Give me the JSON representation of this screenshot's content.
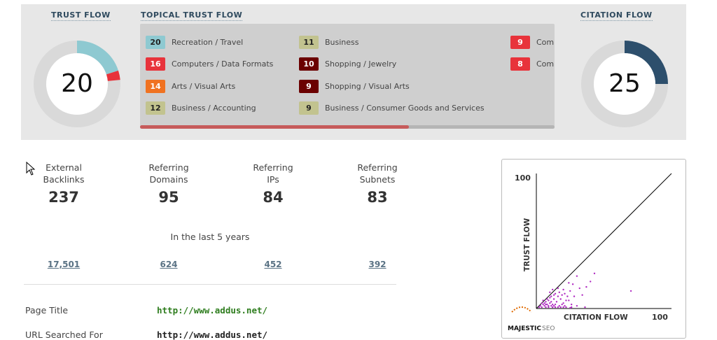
{
  "trust_flow": {
    "title": "TRUST FLOW",
    "value": "20",
    "level": 20,
    "colors": [
      "#8ec9d1",
      "#e8333b"
    ]
  },
  "citation_flow": {
    "title": "CITATION FLOW",
    "value": "25",
    "level": 25,
    "color": "#2d4f6c"
  },
  "topical": {
    "title": "TOPICAL TRUST FLOW",
    "items": [
      {
        "score": "20",
        "label": "Recreation / Travel",
        "color": "#8ec9d1"
      },
      {
        "score": "16",
        "label": "Computers / Data Formats",
        "color": "#e8333b"
      },
      {
        "score": "14",
        "label": "Arts / Visual Arts",
        "color": "#f07221"
      },
      {
        "score": "12",
        "label": "Business / Accounting",
        "color": "#c2c38f"
      },
      {
        "score": "11",
        "label": "Business",
        "color": "#c2c38f"
      },
      {
        "score": "10",
        "label": "Shopping / Jewelry",
        "color": "#6b0000"
      },
      {
        "score": "9",
        "label": "Shopping / Visual Arts",
        "color": "#6b0000"
      },
      {
        "score": "9",
        "label": "Business / Consumer Goods and Services",
        "color": "#c2c38f"
      },
      {
        "score": "9",
        "label": "Com",
        "color": "#e8333b"
      },
      {
        "score": "8",
        "label": "Com",
        "color": "#e8333b"
      }
    ]
  },
  "stats": [
    {
      "label_line1": "External",
      "label_line2": "Backlinks",
      "value": "237",
      "history": "17,501"
    },
    {
      "label_line1": "Referring",
      "label_line2": "Domains",
      "value": "95",
      "history": "624"
    },
    {
      "label_line1": "Referring",
      "label_line2": "IPs",
      "value": "84",
      "history": "452"
    },
    {
      "label_line1": "Referring",
      "label_line2": "Subnets",
      "value": "83",
      "history": "392"
    }
  ],
  "period_label": "In the last 5 years",
  "info": {
    "page_title_label": "Page Title",
    "page_title_value": "http://www.addus.net/",
    "url_label": "URL Searched For",
    "url_value": "http://www.addus.net/"
  },
  "chart_data": {
    "type": "scatter",
    "xlabel": "CITATION FLOW",
    "ylabel": "TRUST FLOW",
    "x_max_label": "100",
    "y_max_label": "100",
    "xlim": [
      0,
      100
    ],
    "ylim": [
      0,
      100
    ],
    "diagonal": true,
    "point_color": "#b02cc2",
    "points": [
      [
        2,
        1
      ],
      [
        3,
        2
      ],
      [
        4,
        1
      ],
      [
        5,
        3
      ],
      [
        5,
        6
      ],
      [
        6,
        2
      ],
      [
        6,
        4
      ],
      [
        7,
        5
      ],
      [
        7,
        1
      ],
      [
        8,
        3
      ],
      [
        8,
        7
      ],
      [
        9,
        6
      ],
      [
        9,
        2
      ],
      [
        10,
        8
      ],
      [
        10,
        4
      ],
      [
        10,
        12
      ],
      [
        11,
        5
      ],
      [
        11,
        9
      ],
      [
        12,
        3
      ],
      [
        12,
        14
      ],
      [
        13,
        7
      ],
      [
        13,
        10
      ],
      [
        14,
        1
      ],
      [
        14,
        11
      ],
      [
        15,
        5
      ],
      [
        16,
        9
      ],
      [
        16,
        15
      ],
      [
        17,
        2
      ],
      [
        17,
        12
      ],
      [
        18,
        7
      ],
      [
        19,
        10
      ],
      [
        20,
        14
      ],
      [
        20,
        4
      ],
      [
        21,
        11
      ],
      [
        22,
        6
      ],
      [
        23,
        9
      ],
      [
        24,
        19
      ],
      [
        25,
        13
      ],
      [
        26,
        3
      ],
      [
        27,
        18
      ],
      [
        28,
        9
      ],
      [
        30,
        24
      ],
      [
        32,
        15
      ],
      [
        34,
        10
      ],
      [
        37,
        16
      ],
      [
        40,
        20
      ],
      [
        43,
        26
      ],
      [
        36,
        1
      ],
      [
        22,
        1
      ],
      [
        30,
        2
      ],
      [
        18,
        1
      ],
      [
        26,
        1
      ],
      [
        14,
        3
      ],
      [
        20,
        1
      ],
      [
        9,
        1
      ],
      [
        12,
        1
      ],
      [
        24,
        6
      ],
      [
        16,
        1
      ],
      [
        25,
        0.5
      ],
      [
        11,
        2
      ],
      [
        13,
        2
      ],
      [
        7,
        3
      ],
      [
        4,
        4
      ],
      [
        19,
        3
      ],
      [
        21,
        2
      ],
      [
        70,
        13
      ]
    ],
    "brand": "MAJESTIC",
    "brand_suffix": "SEO"
  }
}
